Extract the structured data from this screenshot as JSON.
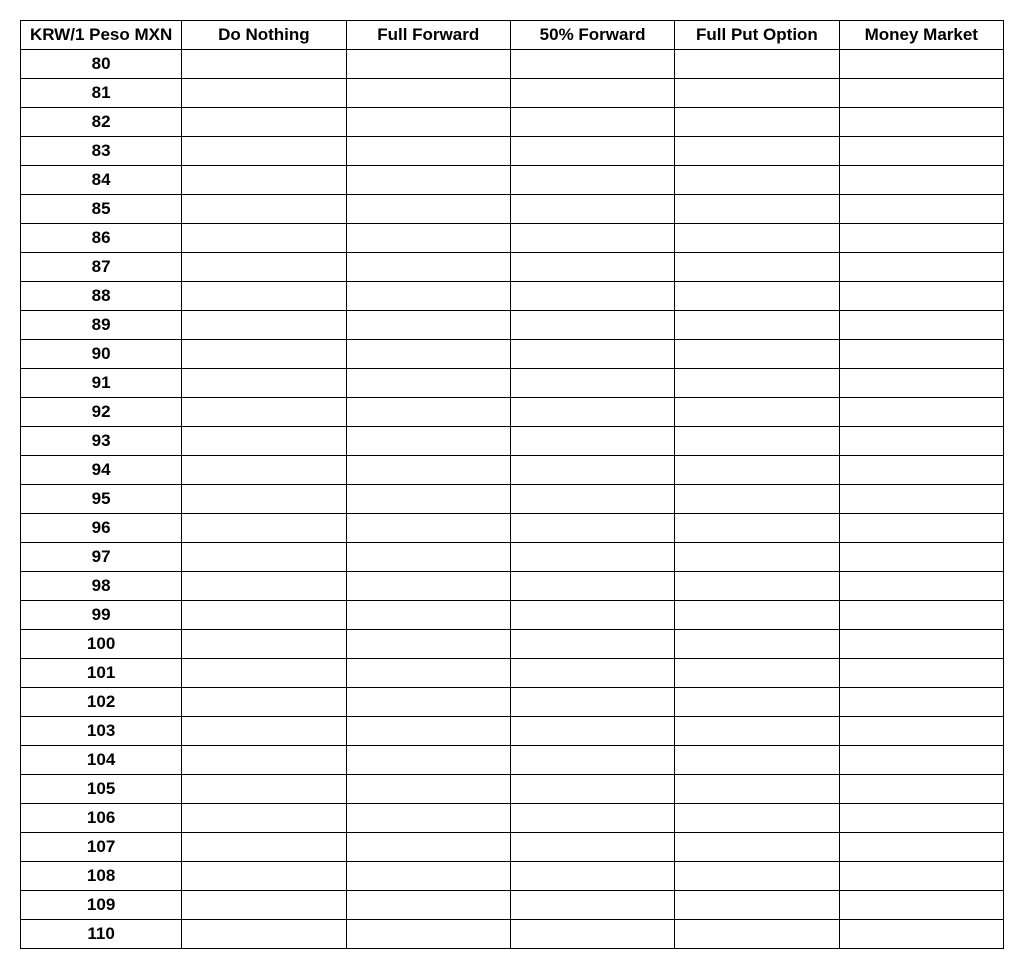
{
  "chart_data": {
    "type": "table",
    "headers": [
      "KRW/1 Peso MXN",
      "Do Nothing",
      "Full Forward",
      "50% Forward",
      "Full Put Option",
      "Money Market"
    ],
    "rows": [
      {
        "rate": "80",
        "do_nothing": "",
        "full_forward": "",
        "fifty_forward": "",
        "full_put": "",
        "money_market": ""
      },
      {
        "rate": "81",
        "do_nothing": "",
        "full_forward": "",
        "fifty_forward": "",
        "full_put": "",
        "money_market": ""
      },
      {
        "rate": "82",
        "do_nothing": "",
        "full_forward": "",
        "fifty_forward": "",
        "full_put": "",
        "money_market": ""
      },
      {
        "rate": "83",
        "do_nothing": "",
        "full_forward": "",
        "fifty_forward": "",
        "full_put": "",
        "money_market": ""
      },
      {
        "rate": "84",
        "do_nothing": "",
        "full_forward": "",
        "fifty_forward": "",
        "full_put": "",
        "money_market": ""
      },
      {
        "rate": "85",
        "do_nothing": "",
        "full_forward": "",
        "fifty_forward": "",
        "full_put": "",
        "money_market": ""
      },
      {
        "rate": "86",
        "do_nothing": "",
        "full_forward": "",
        "fifty_forward": "",
        "full_put": "",
        "money_market": ""
      },
      {
        "rate": "87",
        "do_nothing": "",
        "full_forward": "",
        "fifty_forward": "",
        "full_put": "",
        "money_market": ""
      },
      {
        "rate": "88",
        "do_nothing": "",
        "full_forward": "",
        "fifty_forward": "",
        "full_put": "",
        "money_market": ""
      },
      {
        "rate": "89",
        "do_nothing": "",
        "full_forward": "",
        "fifty_forward": "",
        "full_put": "",
        "money_market": ""
      },
      {
        "rate": "90",
        "do_nothing": "",
        "full_forward": "",
        "fifty_forward": "",
        "full_put": "",
        "money_market": ""
      },
      {
        "rate": "91",
        "do_nothing": "",
        "full_forward": "",
        "fifty_forward": "",
        "full_put": "",
        "money_market": ""
      },
      {
        "rate": "92",
        "do_nothing": "",
        "full_forward": "",
        "fifty_forward": "",
        "full_put": "",
        "money_market": ""
      },
      {
        "rate": "93",
        "do_nothing": "",
        "full_forward": "",
        "fifty_forward": "",
        "full_put": "",
        "money_market": ""
      },
      {
        "rate": "94",
        "do_nothing": "",
        "full_forward": "",
        "fifty_forward": "",
        "full_put": "",
        "money_market": ""
      },
      {
        "rate": "95",
        "do_nothing": "",
        "full_forward": "",
        "fifty_forward": "",
        "full_put": "",
        "money_market": ""
      },
      {
        "rate": "96",
        "do_nothing": "",
        "full_forward": "",
        "fifty_forward": "",
        "full_put": "",
        "money_market": ""
      },
      {
        "rate": "97",
        "do_nothing": "",
        "full_forward": "",
        "fifty_forward": "",
        "full_put": "",
        "money_market": ""
      },
      {
        "rate": "98",
        "do_nothing": "",
        "full_forward": "",
        "fifty_forward": "",
        "full_put": "",
        "money_market": ""
      },
      {
        "rate": "99",
        "do_nothing": "",
        "full_forward": "",
        "fifty_forward": "",
        "full_put": "",
        "money_market": ""
      },
      {
        "rate": "100",
        "do_nothing": "",
        "full_forward": "",
        "fifty_forward": "",
        "full_put": "",
        "money_market": ""
      },
      {
        "rate": "101",
        "do_nothing": "",
        "full_forward": "",
        "fifty_forward": "",
        "full_put": "",
        "money_market": ""
      },
      {
        "rate": "102",
        "do_nothing": "",
        "full_forward": "",
        "fifty_forward": "",
        "full_put": "",
        "money_market": ""
      },
      {
        "rate": "103",
        "do_nothing": "",
        "full_forward": "",
        "fifty_forward": "",
        "full_put": "",
        "money_market": ""
      },
      {
        "rate": "104",
        "do_nothing": "",
        "full_forward": "",
        "fifty_forward": "",
        "full_put": "",
        "money_market": ""
      },
      {
        "rate": "105",
        "do_nothing": "",
        "full_forward": "",
        "fifty_forward": "",
        "full_put": "",
        "money_market": ""
      },
      {
        "rate": "106",
        "do_nothing": "",
        "full_forward": "",
        "fifty_forward": "",
        "full_put": "",
        "money_market": ""
      },
      {
        "rate": "107",
        "do_nothing": "",
        "full_forward": "",
        "fifty_forward": "",
        "full_put": "",
        "money_market": ""
      },
      {
        "rate": "108",
        "do_nothing": "",
        "full_forward": "",
        "fifty_forward": "",
        "full_put": "",
        "money_market": ""
      },
      {
        "rate": "109",
        "do_nothing": "",
        "full_forward": "",
        "fifty_forward": "",
        "full_put": "",
        "money_market": ""
      },
      {
        "rate": "110",
        "do_nothing": "",
        "full_forward": "",
        "fifty_forward": "",
        "full_put": "",
        "money_market": ""
      }
    ]
  }
}
